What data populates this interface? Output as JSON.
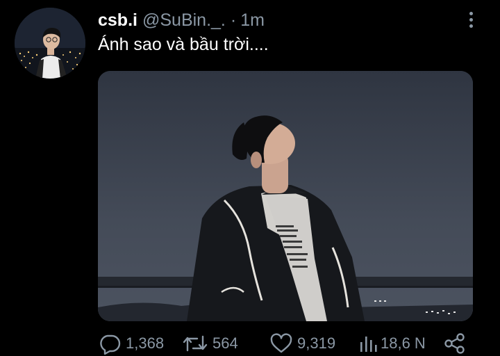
{
  "tweet": {
    "author": {
      "display_name": "csb.i",
      "handle": "@SuBin._.",
      "separator": "·",
      "timestamp": "1m",
      "avatar_icon": "profile-photo"
    },
    "text": "Ánh sao và bầu trời....",
    "media": {
      "kind": "photo",
      "alt_subject": "person looking up at night sky"
    },
    "actions": {
      "reply_count": "1,368",
      "retweet_count": "564",
      "like_count": "9,319",
      "views_count": "18,6 N"
    },
    "icons": {
      "more": "more-vertical-icon",
      "reply": "reply-icon",
      "retweet": "retweet-icon",
      "like": "heart-icon",
      "views": "views-chart-icon",
      "share": "share-icon"
    }
  },
  "colors": {
    "background": "#000000",
    "primary_text": "#ffffff",
    "secondary_text": "#8b98a5"
  }
}
